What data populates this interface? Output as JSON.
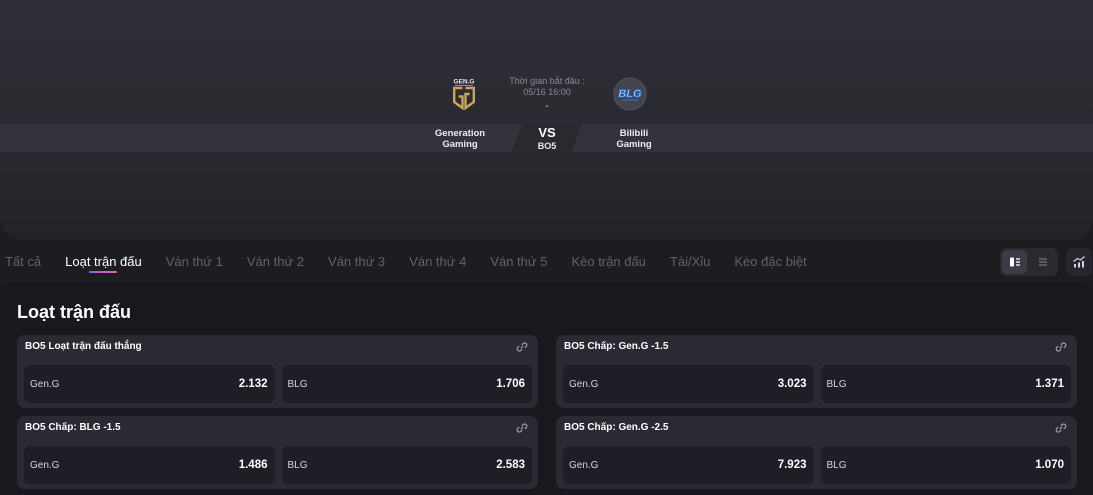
{
  "match": {
    "start_label": "Thời gian bắt đầu :",
    "start_time": "05/16 16:00",
    "score": "-",
    "vs": "VS",
    "format": "BO5",
    "home_team": {
      "name": "Generation Gaming",
      "logo": "gen-g-logo",
      "logo_text": "GEN.G"
    },
    "away_team": {
      "name": "Bilibili Gaming",
      "logo": "blg-logo",
      "logo_text": "BLG"
    }
  },
  "tabs": [
    {
      "label": "Tất cả",
      "active": false
    },
    {
      "label": "Loạt trận đấu",
      "active": true
    },
    {
      "label": "Ván thứ 1",
      "active": false
    },
    {
      "label": "Ván thứ 2",
      "active": false
    },
    {
      "label": "Ván thứ 3",
      "active": false
    },
    {
      "label": "Ván thứ 4",
      "active": false
    },
    {
      "label": "Ván thứ 5",
      "active": false
    },
    {
      "label": "Kèo trận đấu",
      "active": false
    },
    {
      "label": "Tài/Xỉu",
      "active": false
    },
    {
      "label": "Kèo đặc biệt",
      "active": false
    }
  ],
  "toolbar": {
    "view_options": [
      {
        "icon": "card-view-icon",
        "selected": true
      },
      {
        "icon": "list-view-icon",
        "selected": false
      }
    ],
    "stats_icon": "chart-icon"
  },
  "section": {
    "title": "Loạt trận đấu",
    "markets": [
      {
        "title": "BO5 Loạt trận đấu thắng",
        "link_icon": "link-icon",
        "outcomes": [
          {
            "team": "Gen.G",
            "odds": "2.132"
          },
          {
            "team": "BLG",
            "odds": "1.706"
          }
        ]
      },
      {
        "title": "BO5 Chấp: Gen.G -1.5",
        "link_icon": "link-icon",
        "outcomes": [
          {
            "team": "Gen.G",
            "odds": "3.023"
          },
          {
            "team": "BLG",
            "odds": "1.371"
          }
        ]
      },
      {
        "title": "BO5 Chấp: BLG -1.5",
        "link_icon": "link-icon",
        "outcomes": [
          {
            "team": "Gen.G",
            "odds": "1.486"
          },
          {
            "team": "BLG",
            "odds": "2.583"
          }
        ]
      },
      {
        "title": "BO5 Chấp: Gen.G -2.5",
        "link_icon": "link-icon",
        "outcomes": [
          {
            "team": "Gen.G",
            "odds": "7.923"
          },
          {
            "team": "BLG",
            "odds": "1.070"
          }
        ]
      }
    ]
  },
  "colors": {
    "page_background": "#1c1c21",
    "panel_background": "#18181e",
    "card_background": "#2a2a32",
    "odds_button_background": "#1e1e26",
    "text_primary": "#ffffff",
    "text_muted": "#62626e",
    "tab_indicator_start": "#8b5cff",
    "tab_indicator_end": "#ff5c9e",
    "gen_g_gold": "#c9a45c",
    "blg_blue": "#2e6ae6"
  }
}
